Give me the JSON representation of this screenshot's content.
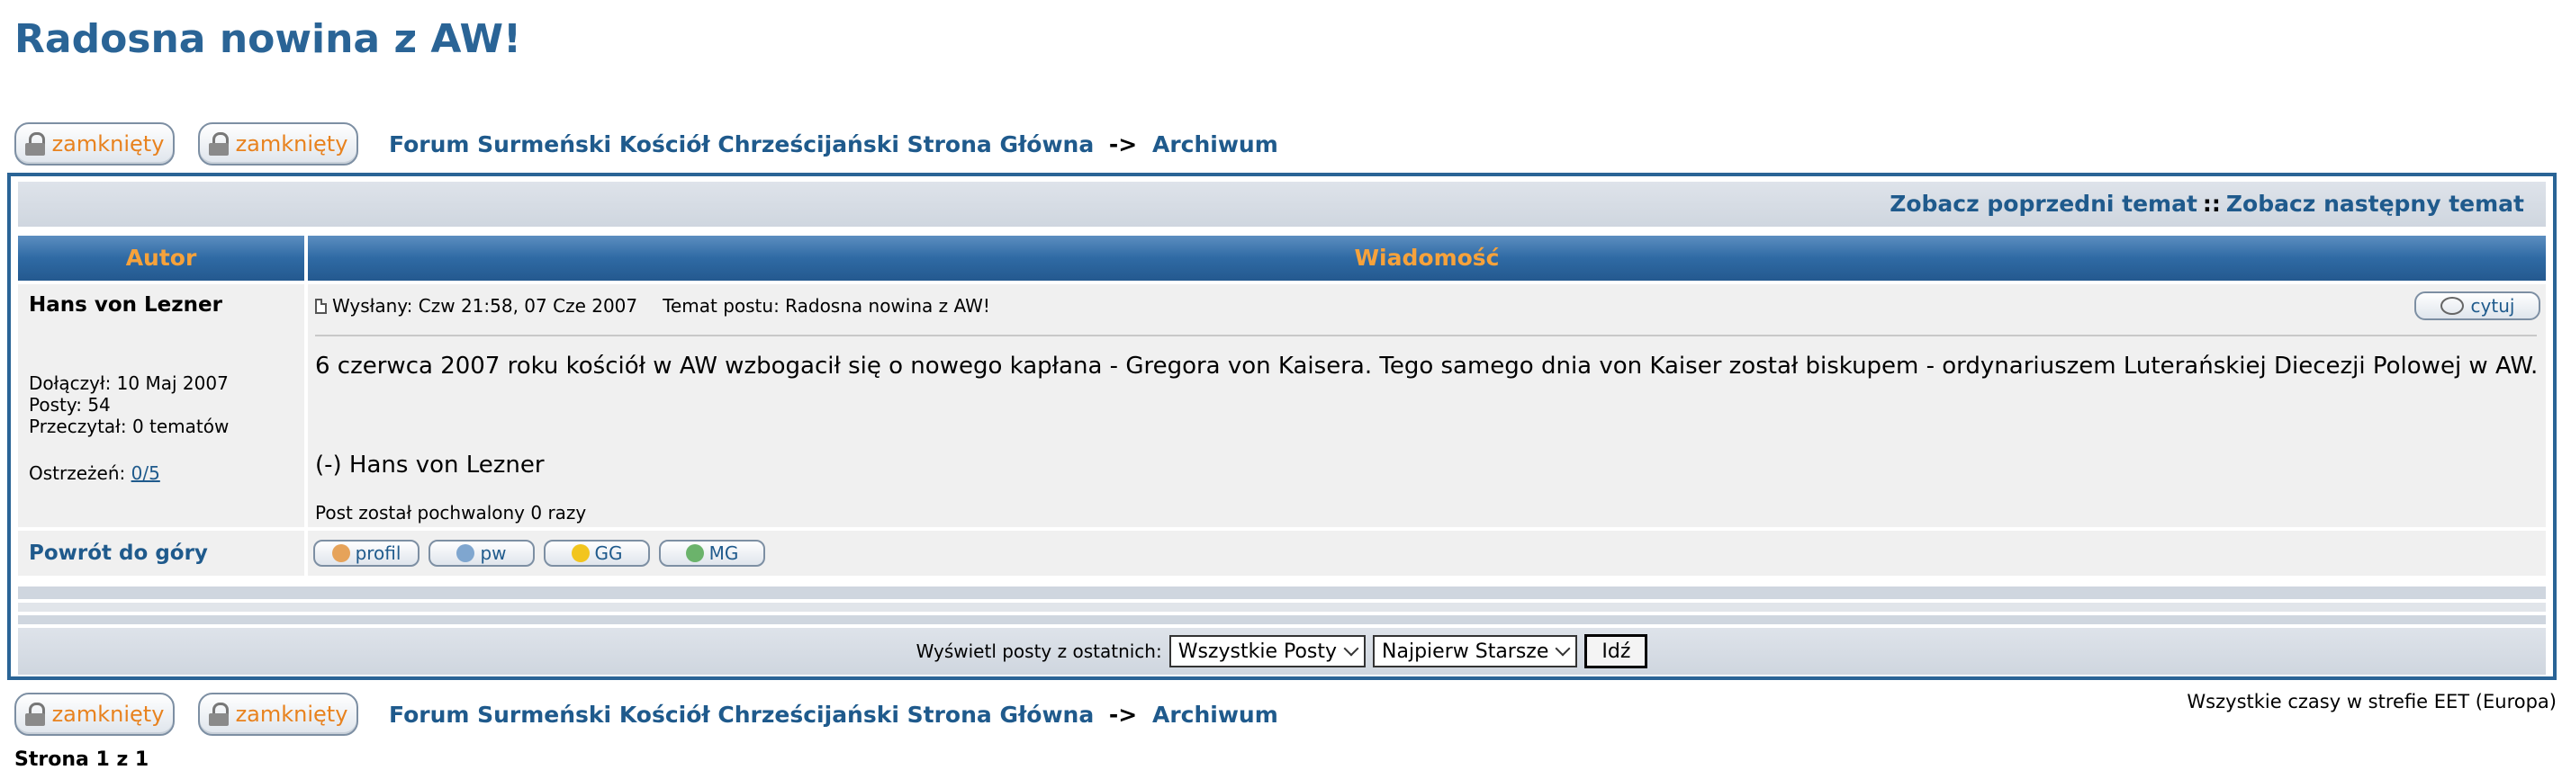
{
  "page": {
    "title": "Radosna nowina z AW!"
  },
  "nav": {
    "locked_label": "zamknięty",
    "forum_link": "Forum Surmeński Kościół Chrześcijański Strona Główna",
    "separator": "->",
    "archive_link": "Archiwum"
  },
  "topic_nav": {
    "prev": "Zobacz poprzedni temat",
    "separator": "::",
    "next": "Zobacz następny temat"
  },
  "table_header": {
    "author": "Autor",
    "message": "Wiadomość"
  },
  "post": {
    "author": "Hans von Lezner",
    "joined": "Dołączył: 10 Maj 2007",
    "posts": "Posty: 54",
    "read": "Przeczytał: 0 tematów",
    "warnings_label": "Ostrzeżeń:",
    "warnings_value": "0/5",
    "posted": "Wysłany: Czw 21:58, 07 Cze 2007",
    "subject": "Temat postu: Radosna nowina z AW!",
    "quote_label": "cytuj",
    "body": "6 czerwca 2007 roku kościół w AW wzbogacił się o nowego kapłana - Gregora von Kaisera. Tego samego dnia von Kaiser został biskupem - ordynariuszem Luterańskiej Diecezji Polowej w AW.",
    "signature": "(-) Hans von Lezner",
    "praise": "Post został pochwalony 0 razy",
    "back_to_top": "Powrót do góry",
    "actions": [
      "profil",
      "pw",
      "GG",
      "MG"
    ]
  },
  "filter": {
    "label": "Wyświetl posty z ostatnich:",
    "range_value": "Wszystkie Posty",
    "order_value": "Najpierw Starsze",
    "go_label": "Idź"
  },
  "footer": {
    "timezone": "Wszystkie czasy w strefie EET (Europa)",
    "pages": "Strona 1 z 1"
  },
  "colors": {
    "link": "#1f5a8c",
    "header_text": "#f6a23b",
    "header_bg": "#2f6aa4",
    "lock_text": "#e8821e"
  }
}
